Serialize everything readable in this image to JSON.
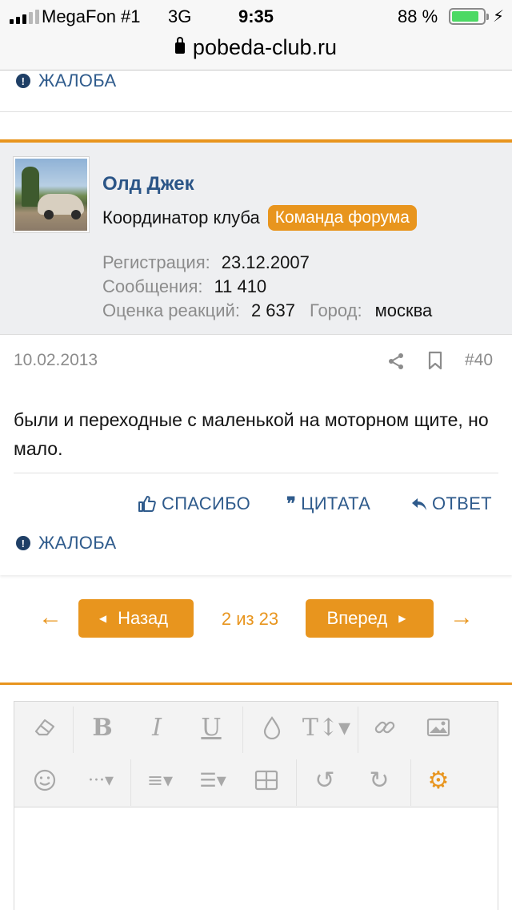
{
  "status_bar": {
    "carrier": "MegaFon #1",
    "network": "3G",
    "time": "9:35",
    "battery": "88 %",
    "battery_level": 0.88
  },
  "browser": {
    "url": "pobeda-club.ru"
  },
  "prev_post": {
    "report_label": "ЖАЛОБА"
  },
  "post": {
    "username": "Олд Джек",
    "user_title": "Координатор клуба",
    "user_badge": "Команда форума",
    "stats": {
      "registration_label": "Регистрация:",
      "registration_value": "23.12.2007",
      "messages_label": "Сообщения:",
      "messages_value": "11 410",
      "reactions_label": "Оценка реакций:",
      "reactions_value": "2 637",
      "city_label": "Город:",
      "city_value": "москва"
    },
    "date": "10.02.2013",
    "number": "#40",
    "text": "были и переходные с маленькой на моторном щите, но мало.",
    "actions": {
      "like": "СПАСИБО",
      "quote": "ЦИТАТА",
      "reply": "ОТВЕТ",
      "report": "ЖАЛОБА"
    }
  },
  "pagination": {
    "prev_label": "Назад",
    "next_label": "Вперед",
    "info": "2 из 23"
  },
  "editor": {
    "toolbar_icons": [
      "eraser-icon",
      "bold-icon",
      "italic-icon",
      "underline-icon",
      "color-icon",
      "text-size-icon",
      "link-icon",
      "image-icon",
      "smiley-icon",
      "more-icon",
      "align-icon",
      "list-icon",
      "table-icon",
      "undo-icon",
      "redo-icon",
      "settings-icon"
    ]
  },
  "colors": {
    "accent": "#e8951e",
    "link": "#2f5b8c",
    "username": "#2b5587"
  }
}
